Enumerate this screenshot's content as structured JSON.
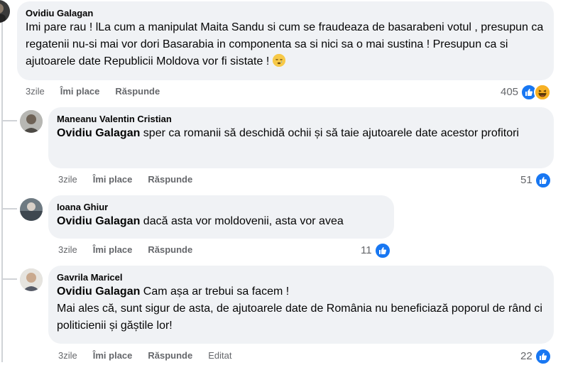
{
  "comments": [
    {
      "author": "Ovidiu Galagan",
      "text": "Imi pare rau ! lLa cum a manipulat Maita Sandu si cum se fraudeaza de basarabeni votul , presupun ca regatenii nu-si mai vor dori Basarabia in componenta sa si nici sa o mai sustina ! Presupun ca si ajutoarele date Republicii Moldova vor fi sistate !",
      "time": "3zile",
      "like_label": "Îmi place",
      "reply_label": "Răspunde",
      "reaction_count": "405",
      "emoji_name": "sleepy-face-emoji"
    },
    {
      "author": "Maneanu Valentin Cristian",
      "mention": "Ovidiu Galagan",
      "text": " sper ca romanii să deschidă ochii și să taie ajutoarele date acestor profitori",
      "time": "3zile",
      "like_label": "Îmi place",
      "reply_label": "Răspunde",
      "reaction_count": "51"
    },
    {
      "author": "Ioana Ghiur",
      "mention": "Ovidiu Galagan",
      "text": " dacă asta vor moldovenii, asta vor avea",
      "time": "3zile",
      "like_label": "Îmi place",
      "reply_label": "Răspunde",
      "reaction_count": "11"
    },
    {
      "author": "Gavrila Maricel",
      "mention": "Ovidiu Galagan",
      "text": " Cam așa ar trebui sa facem !",
      "text2": "Mai ales că, sunt sigur de asta, de ajutoarele date de România nu beneficiază poporul de rând ci politicienii și găștile lor!",
      "time": "3zile",
      "like_label": "Îmi place",
      "reply_label": "Răspunde",
      "edited_label": "Editat",
      "reaction_count": "22"
    }
  ],
  "colors": {
    "bubble": "#f0f2f5",
    "like": "#1877f2",
    "meta": "#65676b"
  }
}
